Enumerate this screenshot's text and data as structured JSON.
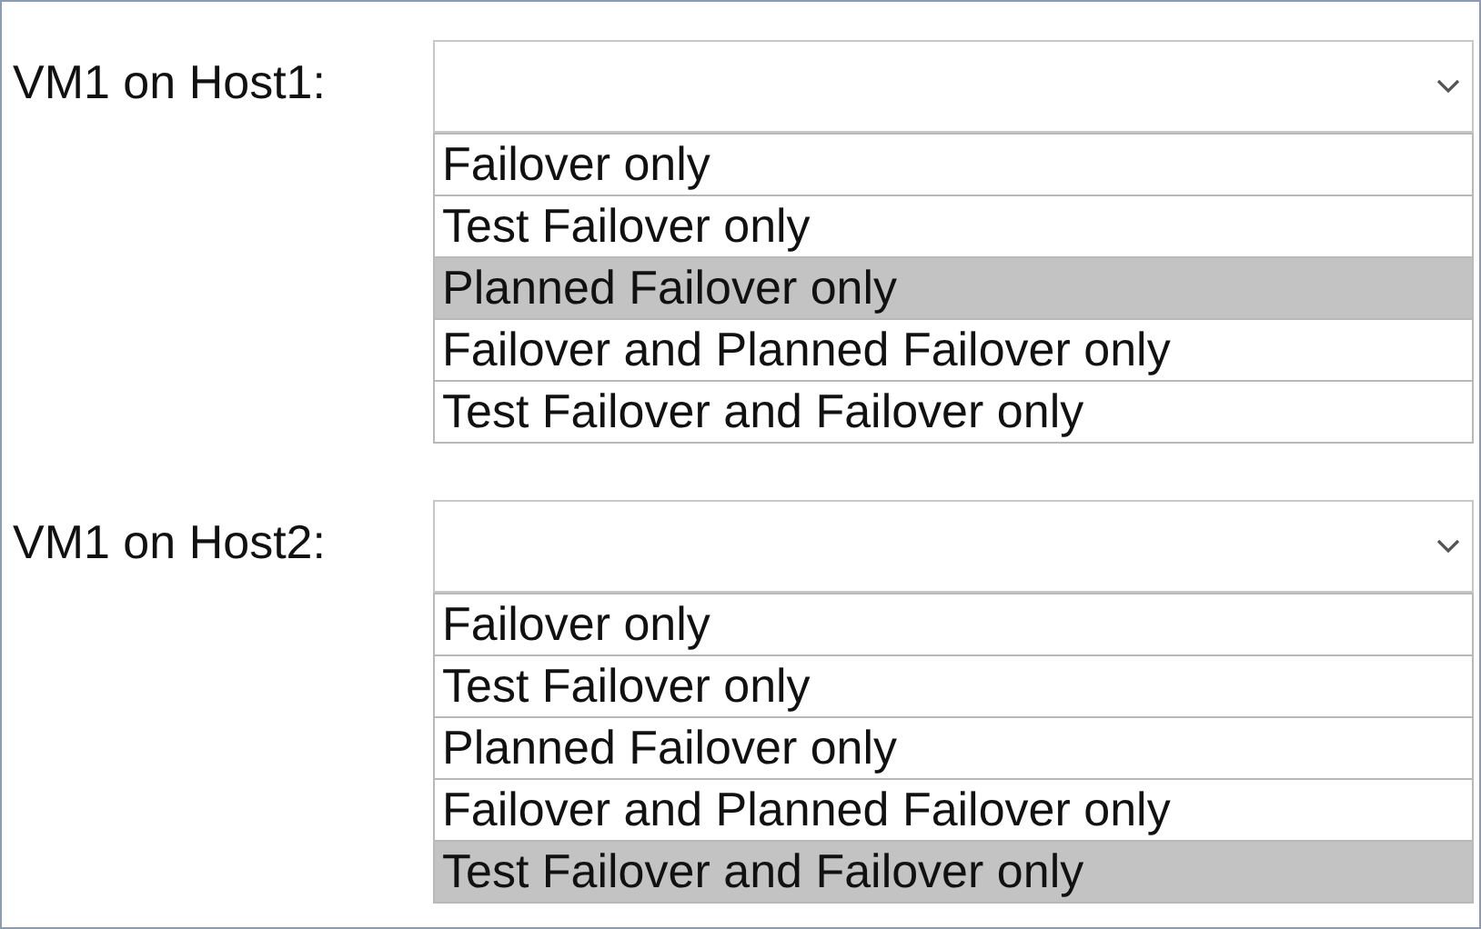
{
  "questions": [
    {
      "label": "VM1 on Host1:",
      "options": [
        {
          "label": "Failover only",
          "selected": false
        },
        {
          "label": "Test Failover only",
          "selected": false
        },
        {
          "label": "Planned Failover only",
          "selected": true
        },
        {
          "label": "Failover and Planned Failover only",
          "selected": false
        },
        {
          "label": "Test Failover and Failover only",
          "selected": false
        }
      ]
    },
    {
      "label": "VM1 on Host2:",
      "options": [
        {
          "label": "Failover only",
          "selected": false
        },
        {
          "label": "Test Failover only",
          "selected": false
        },
        {
          "label": "Planned Failover only",
          "selected": false
        },
        {
          "label": "Failover and Planned Failover only",
          "selected": false
        },
        {
          "label": "Test Failover and Failover only",
          "selected": true
        }
      ]
    }
  ]
}
